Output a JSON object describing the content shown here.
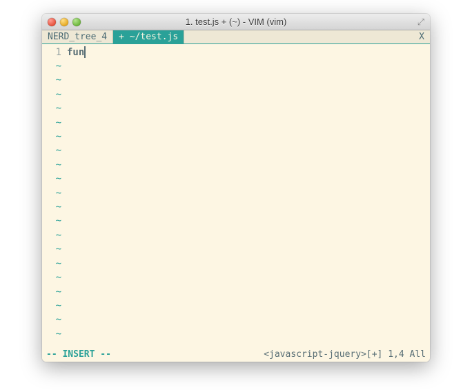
{
  "window": {
    "title": "1. test.js + (~) - VIM (vim)"
  },
  "tabs": {
    "inactive1": "NERD_tree_4",
    "active": "+ ~/test.js",
    "close": "X"
  },
  "editor": {
    "line1_num": "1",
    "line1_text": "fun",
    "tilde": "~"
  },
  "status": {
    "mode": "-- INSERT --",
    "right": "<javascript-jquery>[+] 1,4 All"
  }
}
